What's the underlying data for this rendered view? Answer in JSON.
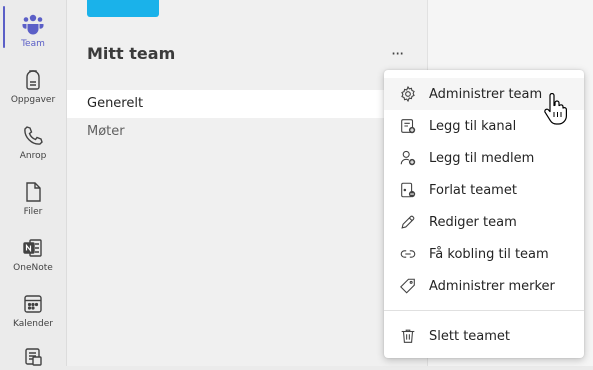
{
  "rail": {
    "items": [
      {
        "label": "Team",
        "icon": "teams-icon"
      },
      {
        "label": "Oppgaver",
        "icon": "tasks-icon"
      },
      {
        "label": "Anrop",
        "icon": "phone-icon"
      },
      {
        "label": "Filer",
        "icon": "file-icon"
      },
      {
        "label": "OneNote",
        "icon": "onenote-icon"
      },
      {
        "label": "Kalender",
        "icon": "calendar-icon"
      },
      {
        "label": "",
        "icon": "app-icon"
      }
    ],
    "active_color": "#5b5fc7"
  },
  "team": {
    "name": "Mitt team",
    "more": "···",
    "avatar_color": "#1ab2ea",
    "channels": [
      {
        "label": "Generelt",
        "selected": true
      },
      {
        "label": "Møter",
        "selected": false
      }
    ]
  },
  "menu": {
    "items": [
      {
        "label": "Administrer team",
        "icon": "gear-icon"
      },
      {
        "label": "Legg til kanal",
        "icon": "add-channel-icon"
      },
      {
        "label": "Legg til medlem",
        "icon": "add-member-icon"
      },
      {
        "label": "Forlat teamet",
        "icon": "leave-team-icon"
      },
      {
        "label": "Rediger team",
        "icon": "pencil-icon"
      },
      {
        "label": "Få kobling til team",
        "icon": "link-icon"
      },
      {
        "label": "Administrer merker",
        "icon": "tag-icon"
      }
    ],
    "delete_item": {
      "label": "Slett teamet",
      "icon": "trash-icon"
    }
  }
}
